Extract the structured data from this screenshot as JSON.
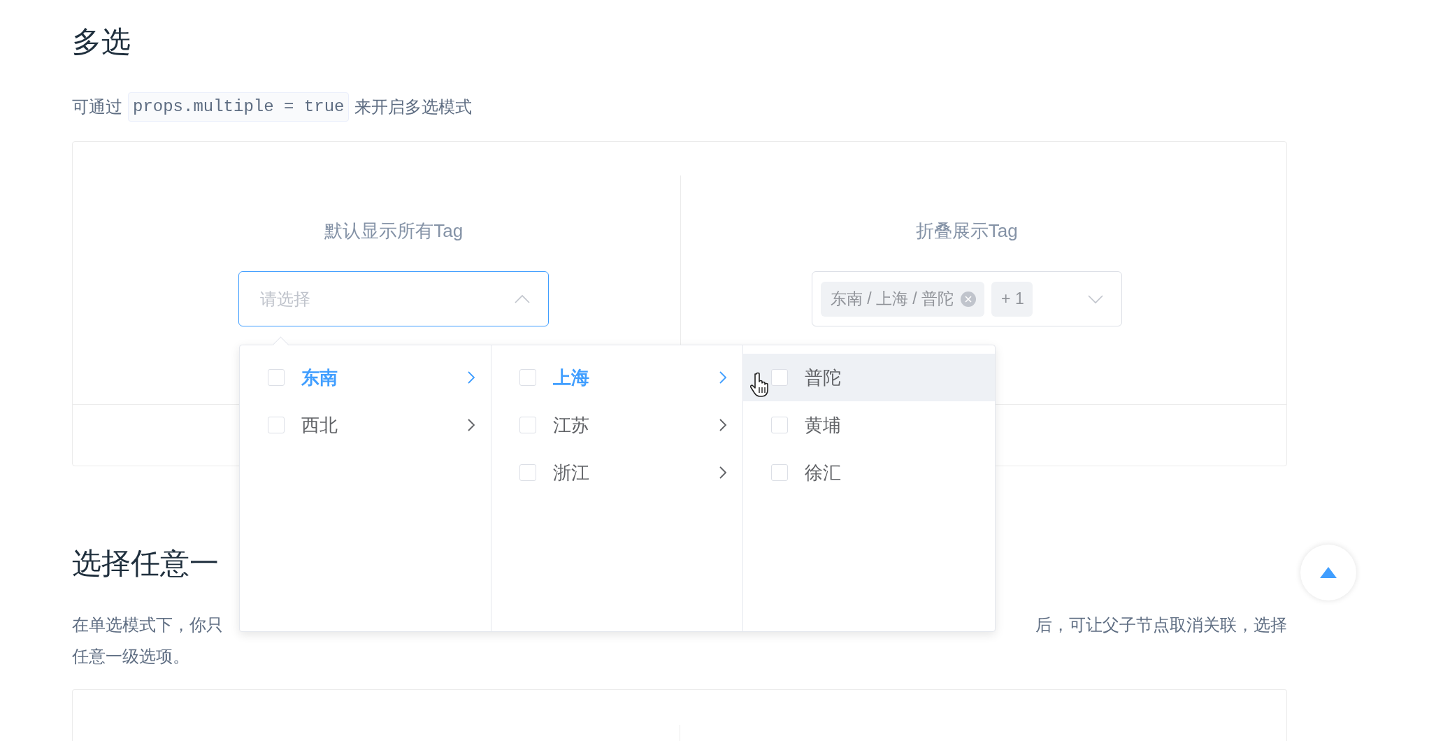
{
  "sections": [
    {
      "title": "多选",
      "intro": {
        "before": "可通过",
        "code": "props.multiple = true",
        "after": "来开启多选模式"
      },
      "demos": [
        {
          "label": "默认显示所有Tag",
          "select": {
            "placeholder": "请选择",
            "open": true
          }
        },
        {
          "label": "折叠展示Tag",
          "select": {
            "open": false,
            "tags": [
              {
                "text": "东南 / 上海 / 普陀",
                "closable": true
              },
              {
                "text": "+ 1",
                "closable": false
              }
            ]
          }
        }
      ],
      "cascader_menu": [
        [
          {
            "label": "东南",
            "checked": false,
            "selected": true,
            "has_children": true,
            "hovered": false
          },
          {
            "label": "西北",
            "checked": false,
            "selected": false,
            "has_children": true,
            "hovered": false
          }
        ],
        [
          {
            "label": "上海",
            "checked": false,
            "selected": true,
            "has_children": true,
            "hovered": false
          },
          {
            "label": "江苏",
            "checked": false,
            "selected": false,
            "has_children": true,
            "hovered": false
          },
          {
            "label": "浙江",
            "checked": false,
            "selected": false,
            "has_children": true,
            "hovered": false
          }
        ],
        [
          {
            "label": "普陀",
            "checked": false,
            "selected": false,
            "has_children": false,
            "hovered": true
          },
          {
            "label": "黄埔",
            "checked": false,
            "selected": false,
            "has_children": false,
            "hovered": false
          },
          {
            "label": "徐汇",
            "checked": false,
            "selected": false,
            "has_children": false,
            "hovered": false
          }
        ]
      ]
    },
    {
      "title": "选择任意一",
      "description_fragments": [
        "在单选模式下，你只",
        "后，可让父子节点取消关联，选择"
      ],
      "description_line2": "任意一级选项。"
    }
  ]
}
